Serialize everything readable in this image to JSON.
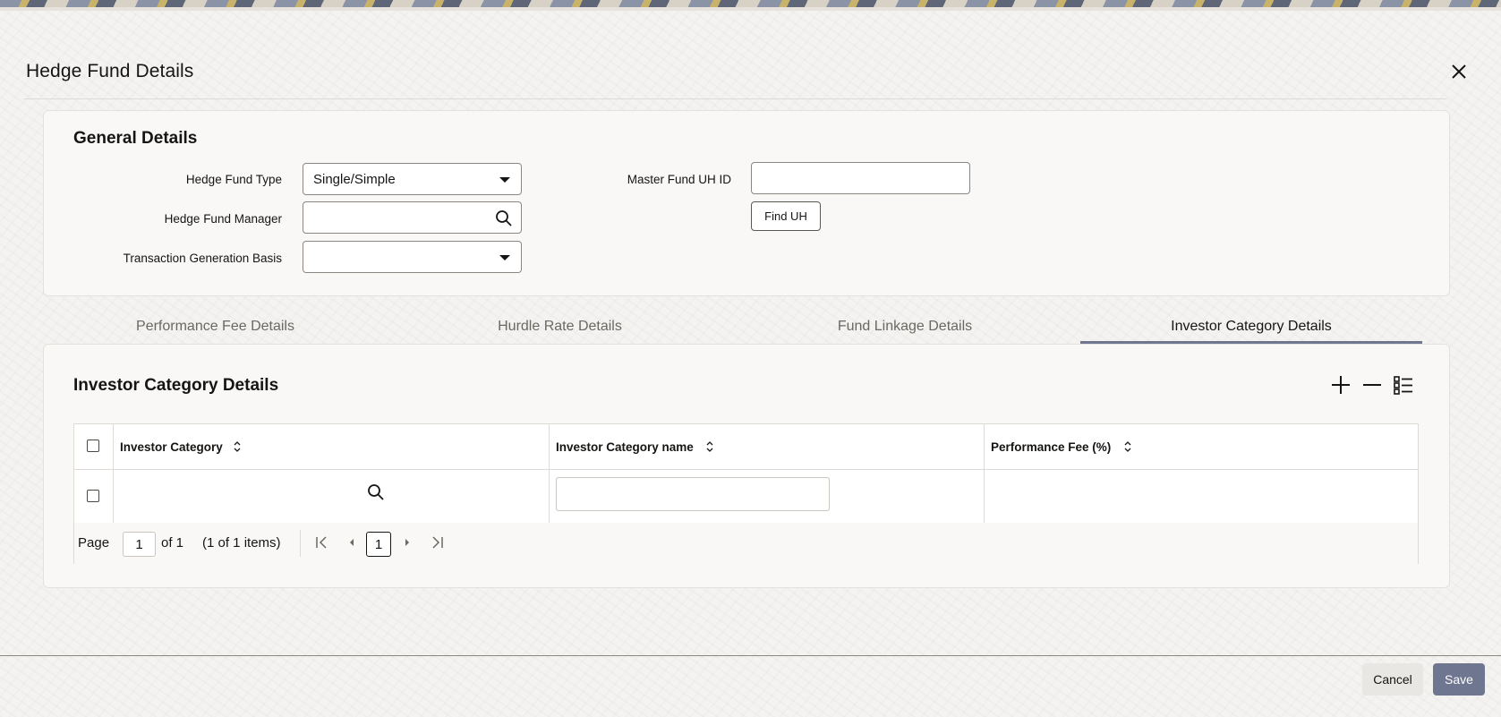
{
  "dialog": {
    "title": "Hedge Fund Details"
  },
  "general": {
    "section_title": "General Details",
    "hedge_fund_type_label": "Hedge Fund Type",
    "hedge_fund_type_value": "Single/Simple",
    "hedge_fund_manager_label": "Hedge Fund Manager",
    "hedge_fund_manager_value": "",
    "transaction_generation_basis_label": "Transaction Generation Basis",
    "transaction_generation_basis_value": "",
    "master_fund_uh_id_label": "Master Fund UH ID",
    "master_fund_uh_id_value": "",
    "find_uh_label": "Find UH"
  },
  "tabs": [
    {
      "label": "Performance Fee Details",
      "active": false
    },
    {
      "label": "Hurdle Rate Details",
      "active": false
    },
    {
      "label": "Fund Linkage Details",
      "active": false
    },
    {
      "label": "Investor Category Details",
      "active": true
    }
  ],
  "investor_grid": {
    "section_title": "Investor Category Details",
    "columns": [
      "Investor Category",
      "Investor Category name",
      "Performance Fee (%)"
    ],
    "rows": [
      {
        "investor_category": "",
        "investor_category_name": "",
        "performance_fee": ""
      }
    ],
    "pager": {
      "page_label": "Page",
      "current_page": "1",
      "of_text": "of 1",
      "items_text": "(1 of 1 items)",
      "page_button": "1"
    }
  },
  "footer": {
    "cancel_label": "Cancel",
    "save_label": "Save"
  },
  "colors": {
    "accent": "#6f7690",
    "text": "#161513"
  }
}
